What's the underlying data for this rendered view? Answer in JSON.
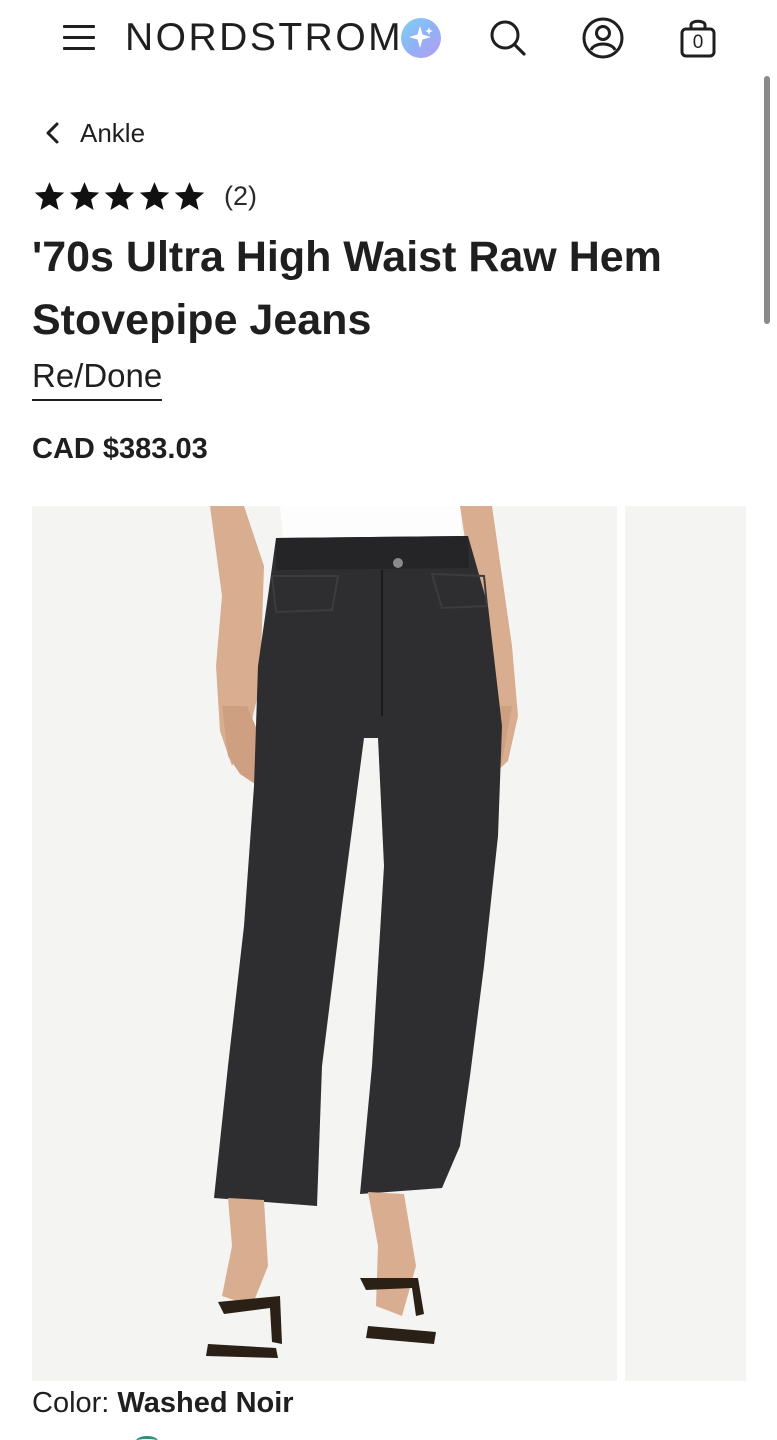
{
  "header": {
    "logo": "NORDSTROM",
    "menu_icon": "hamburger-menu-icon",
    "ai_icon": "sparkle-assistant-icon",
    "search_icon": "search-icon",
    "account_icon": "account-icon",
    "bag_icon": "shopping-bag-icon",
    "bag_count": "0"
  },
  "breadcrumb": {
    "label": "Ankle",
    "icon": "chevron-left-icon"
  },
  "rating": {
    "stars": 5,
    "count": "(2)"
  },
  "product": {
    "title": "'70s Ultra High Waist Raw Hem Stovepipe Jeans",
    "brand": "Re/Done",
    "price": "CAD $383.03"
  },
  "color": {
    "label": "Color:",
    "value": "Washed Noir"
  },
  "colors": {
    "accent": "#1f1f1f",
    "image_bg": "#f4f4f3",
    "denim": "#2e2e30",
    "ai_gradient_start": "#7fd0f5",
    "ai_gradient_end": "#b79cf2"
  }
}
